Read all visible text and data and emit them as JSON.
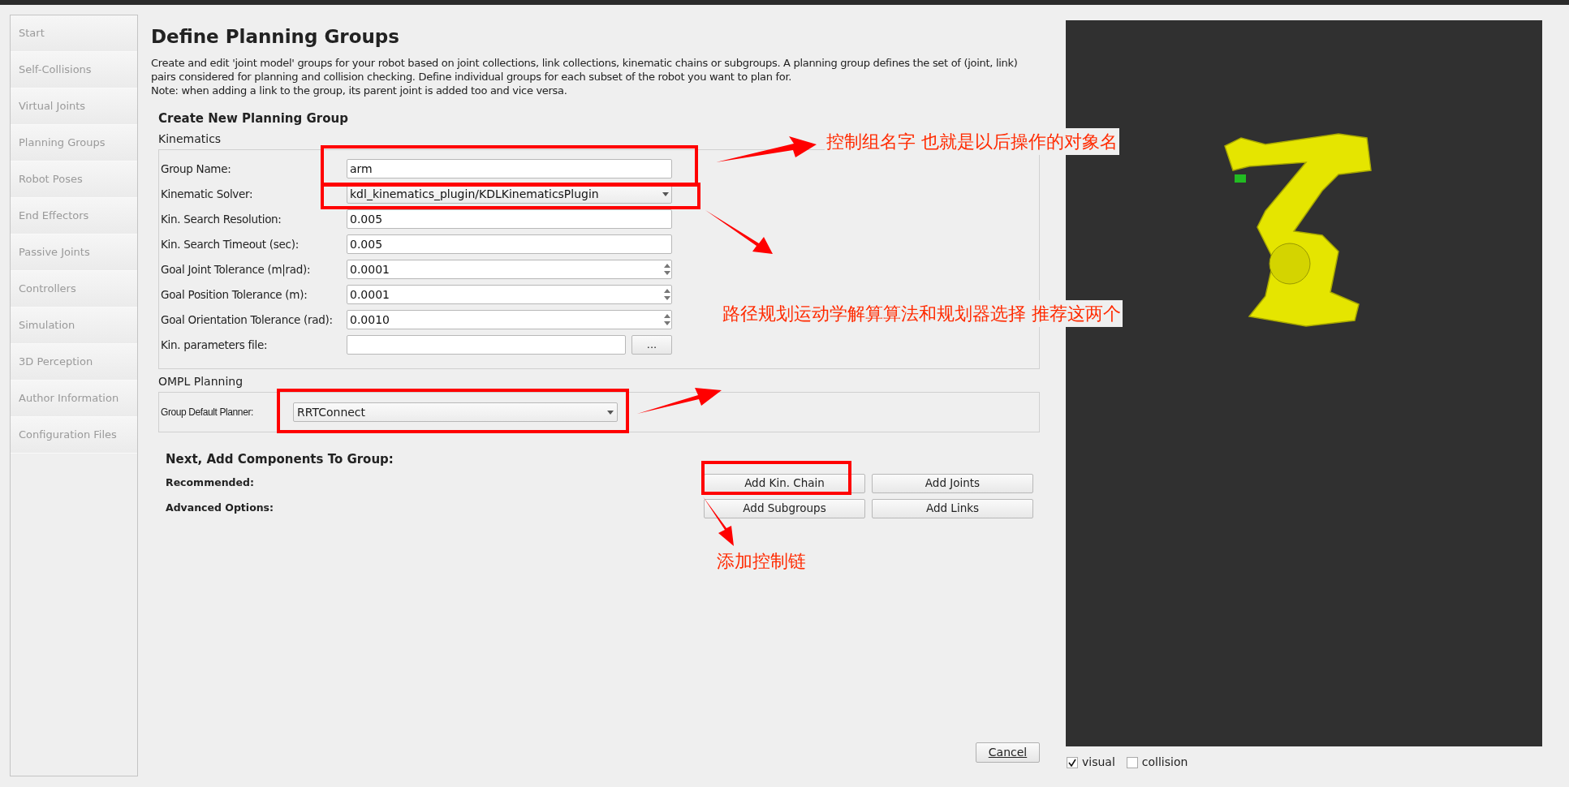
{
  "sidebar": {
    "items": [
      {
        "label": "Start"
      },
      {
        "label": "Self-Collisions"
      },
      {
        "label": "Virtual Joints"
      },
      {
        "label": "Planning Groups"
      },
      {
        "label": "Robot Poses"
      },
      {
        "label": "End Effectors"
      },
      {
        "label": "Passive Joints"
      },
      {
        "label": "Controllers"
      },
      {
        "label": "Simulation"
      },
      {
        "label": "3D Perception"
      },
      {
        "label": "Author Information"
      },
      {
        "label": "Configuration Files"
      }
    ]
  },
  "header": {
    "title": "Define Planning Groups",
    "description": "Create and edit 'joint model' groups for your robot based on joint collections, link collections, kinematic chains or subgroups. A planning group defines the set of (joint, link) pairs considered for planning and collision checking. Define individual groups for each subset of the robot you want to plan for.",
    "note": "Note: when adding a link to the group, its parent joint is added too and vice versa."
  },
  "create_group": {
    "title": "Create New Planning Group",
    "kinematics": {
      "title": "Kinematics",
      "fields": [
        {
          "kind": "text",
          "label": "Group Name:",
          "value": "arm"
        },
        {
          "kind": "combo",
          "label": "Kinematic Solver:",
          "value": "kdl_kinematics_plugin/KDLKinematicsPlugin"
        },
        {
          "kind": "text",
          "label": "Kin. Search Resolution:",
          "value": "0.005"
        },
        {
          "kind": "text",
          "label": "Kin. Search Timeout (sec):",
          "value": "0.005"
        },
        {
          "kind": "spin",
          "label": "Goal Joint Tolerance (m|rad):",
          "value": "0.0001"
        },
        {
          "kind": "spin",
          "label": "Goal Position Tolerance (m):",
          "value": "0.0001"
        },
        {
          "kind": "spin",
          "label": "Goal Orientation Tolerance (rad):",
          "value": "0.0010"
        },
        {
          "kind": "file",
          "label": "Kin. parameters file:",
          "button": "..."
        }
      ]
    },
    "ompl": {
      "title": "OMPL Planning",
      "label": "Group Default Planner:",
      "value": "RRTConnect"
    }
  },
  "components": {
    "title": "Next, Add Components To Group:",
    "rows": [
      {
        "label": "Recommended:",
        "buttons": [
          "Add Kin. Chain",
          "Add Joints"
        ]
      },
      {
        "label": "Advanced Options:",
        "buttons": [
          "Add Subgroups",
          "Add Links"
        ]
      }
    ]
  },
  "cancel": "Cancel",
  "viewer": {
    "checkboxes": [
      {
        "label": "visual",
        "checked": true
      },
      {
        "label": "collision",
        "checked": false
      }
    ]
  },
  "annotations": [
    "控制组名字 也就是以后操作的对象名",
    "路径规划运动学解算算法和规划器选择 推荐这两个",
    "添加控制链"
  ]
}
